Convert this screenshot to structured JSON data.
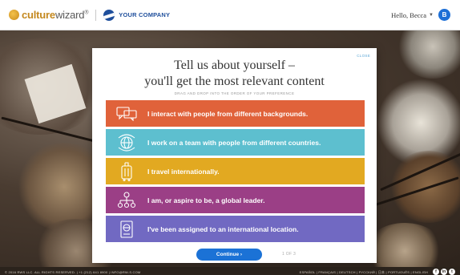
{
  "header": {
    "brand_bold": "culture",
    "brand_light": "wizard",
    "brand_mark": "®",
    "company": "YOUR COMPANY",
    "greeting": "Hello, Becca",
    "avatar_initial": "B"
  },
  "modal": {
    "close_label": "CLOSE",
    "title_line1": "Tell us about yourself –",
    "title_line2": "you'll get the most relevant content",
    "instruction": "DRAG AND DROP INTO THE ORDER OF YOUR PREFERENCE",
    "options": [
      {
        "label": "I interact with people from different backgrounds.",
        "color": "#e0623a",
        "icon": "speech-bubbles-icon"
      },
      {
        "label": "I work on a team with people from different countries.",
        "color": "#5dbfcf",
        "icon": "globe-arrows-icon"
      },
      {
        "label": "I travel internationally.",
        "color": "#e2a921",
        "icon": "luggage-icon"
      },
      {
        "label": "I am, or aspire to be, a global leader.",
        "color": "#9b3f86",
        "icon": "org-chart-icon"
      },
      {
        "label": "I've been assigned to an international location.",
        "color": "#7169c2",
        "icon": "passport-icon"
      }
    ],
    "continue_label": "Continue  ›",
    "pager": "1 OF 3"
  },
  "footer": {
    "copyright": "© 2016 RWS LLC. ALL RIGHTS RESERVED. | +1 (212) 641 8900 | INFO@RW-S.COM",
    "languages": "ESPAÑOL | FRANÇAIS | DEUTSCH | РУССКИЙ | 日本 | PORTUGUÊS | ENGLISH",
    "social": [
      "f",
      "in",
      "t"
    ]
  }
}
